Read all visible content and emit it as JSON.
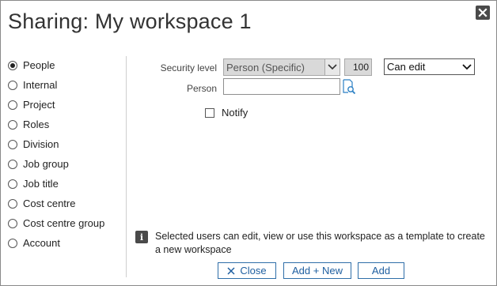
{
  "dialog": {
    "title": "Sharing: My workspace 1"
  },
  "sidebar": {
    "items": [
      {
        "label": "People",
        "selected": true
      },
      {
        "label": "Internal",
        "selected": false
      },
      {
        "label": "Project",
        "selected": false
      },
      {
        "label": "Roles",
        "selected": false
      },
      {
        "label": "Division",
        "selected": false
      },
      {
        "label": "Job group",
        "selected": false
      },
      {
        "label": "Job title",
        "selected": false
      },
      {
        "label": "Cost centre",
        "selected": false
      },
      {
        "label": "Cost centre group",
        "selected": false
      },
      {
        "label": "Account",
        "selected": false
      }
    ]
  },
  "form": {
    "security_level_label": "Security level",
    "security_level_value": "Person (Specific)",
    "level_number": "100",
    "permission_value": "Can edit",
    "person_label": "Person",
    "person_value": "",
    "notify_label": "Notify",
    "notify_checked": false
  },
  "info": {
    "text": "Selected users can edit, view or use this workspace as a template to create a new workspace"
  },
  "buttons": {
    "close_label": "Close",
    "add_new_label": "Add + New",
    "add_label": "Add"
  },
  "colors": {
    "button_text": "#1f5fa0",
    "button_border": "#2f6ea8",
    "disabled_field_bg": "#d9d9d9"
  },
  "icons": [
    "close-icon",
    "lookup-icon",
    "info-icon",
    "chevron-down-icon"
  ]
}
